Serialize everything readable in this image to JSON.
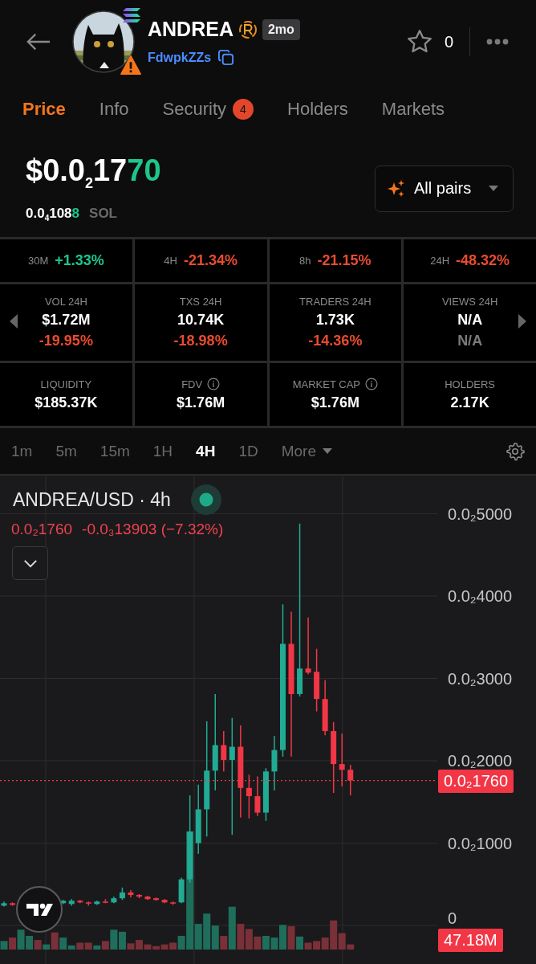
{
  "header": {
    "title": "ANDREA",
    "age": "2mo",
    "address": "FdwpkZZs",
    "warning": true,
    "favorites": "0"
  },
  "tabs": [
    {
      "label": "Price",
      "selected": true
    },
    {
      "label": "Info",
      "selected": false
    },
    {
      "label": "Security",
      "selected": false,
      "badge": "4"
    },
    {
      "label": "Holders",
      "selected": false
    },
    {
      "label": "Markets",
      "selected": false
    }
  ],
  "price": {
    "lead": "$0.0",
    "zeros": "2",
    "digits": "17",
    "tail": "70"
  },
  "native_price": {
    "lead": "0.0",
    "zeros": "4",
    "digits": "108",
    "tail": "8",
    "unit": "SOL"
  },
  "pairs_button": {
    "label": "All pairs"
  },
  "changes": [
    {
      "period": "30M",
      "value": "+1.33%",
      "color": "#1ec58b"
    },
    {
      "period": "4H",
      "value": "-21.34%",
      "color": "#ea4b2e"
    },
    {
      "period": "8h",
      "value": "-21.15%",
      "color": "#ea4b2e"
    },
    {
      "period": "24H",
      "value": "-48.32%",
      "color": "#ea4b2e"
    }
  ],
  "activity": [
    {
      "label": "VOL 24H",
      "value": "$1.72M",
      "change": "-19.95%",
      "color": "#ea4b2e"
    },
    {
      "label": "TXS 24H",
      "value": "10.74K",
      "change": "-18.98%",
      "color": "#ea4b2e"
    },
    {
      "label": "TRADERS 24H",
      "value": "1.73K",
      "change": "-14.36%",
      "color": "#ea4b2e"
    },
    {
      "label": "VIEWS 24H",
      "value": "N/A",
      "change": "N/A",
      "color": "#7a7a7a"
    }
  ],
  "metrics": [
    {
      "label": "LIQUIDITY",
      "value": "$185.37K",
      "info": false
    },
    {
      "label": "FDV",
      "value": "$1.76M",
      "info": true
    },
    {
      "label": "MARKET CAP",
      "value": "$1.76M",
      "info": true
    },
    {
      "label": "HOLDERS",
      "value": "2.17K",
      "info": false
    }
  ],
  "timeframes": [
    {
      "label": "1m",
      "selected": false,
      "kind": "option"
    },
    {
      "label": "5m",
      "selected": false,
      "kind": "option"
    },
    {
      "label": "15m",
      "selected": false,
      "kind": "option"
    },
    {
      "label": "1H",
      "selected": false,
      "kind": "option"
    },
    {
      "label": "4H",
      "selected": true,
      "kind": "option"
    },
    {
      "label": "1D",
      "selected": false,
      "kind": "option"
    },
    {
      "label": "More",
      "selected": false,
      "kind": "dropdown"
    }
  ],
  "chart": {
    "title": "ANDREA/USD · 4h",
    "legend": {
      "price": "0.0₂1760",
      "change": "-0.0₃13903 (−7.32%)"
    },
    "price_tag": "0.0₂1760",
    "volume_tag": "47.18M",
    "axis_labels": [
      "0.0₂5000",
      "0.0₂4000",
      "0.0₂3000",
      "0.0₂2000",
      "0.0₂1000",
      "0"
    ]
  }
}
